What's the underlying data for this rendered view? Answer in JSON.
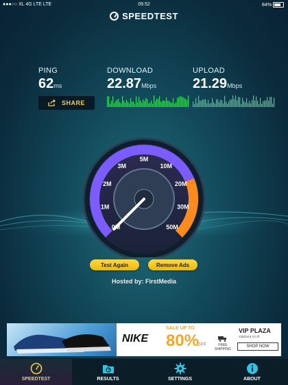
{
  "status_bar": {
    "carrier": "●●●○○ XL 4G LTE  LTE",
    "time": "09.52",
    "battery": "84%"
  },
  "app": {
    "title": "SPEEDTEST"
  },
  "ping": {
    "label": "PING",
    "value": "62",
    "unit": "ms"
  },
  "download": {
    "label": "DOWNLOAD",
    "value": "22.87",
    "unit": "Mbps"
  },
  "upload": {
    "label": "UPLOAD",
    "value": "21.29",
    "unit": "Mbps"
  },
  "share": {
    "label": "SHARE"
  },
  "gauge": {
    "ticks": [
      "0",
      "1",
      "2",
      "3",
      "5",
      "10",
      "20",
      "30",
      "50"
    ],
    "unit_suffix": "M",
    "needle_value_mbps": 0,
    "colors": {
      "ring_purple": "#7a5cff",
      "ring_orange": "#ff8a1e"
    }
  },
  "buttons": {
    "test_again": "Test Again",
    "remove_ads": "Remove Ads"
  },
  "hosted": "Hosted by: FirstMedia",
  "ad": {
    "brand_logo": "NIKE",
    "sale_text": "SALE UP TO",
    "discount": "80%",
    "off_text": "OFF",
    "shipping_text_1": "FREE",
    "shipping_text_2": "SHIPPING",
    "store": "VIP PLAZA",
    "store_url": "vipplaza.co.id",
    "cta": "SHOP NOW"
  },
  "tabs": [
    {
      "label": "SPEEDTEST",
      "icon": "speedometer-icon",
      "active": true
    },
    {
      "label": "RESULTS",
      "icon": "folder-icon",
      "active": false
    },
    {
      "label": "SETTINGS",
      "icon": "gear-icon",
      "active": false
    },
    {
      "label": "ABOUT",
      "icon": "info-icon",
      "active": false
    }
  ],
  "accent": "#f0d04a"
}
